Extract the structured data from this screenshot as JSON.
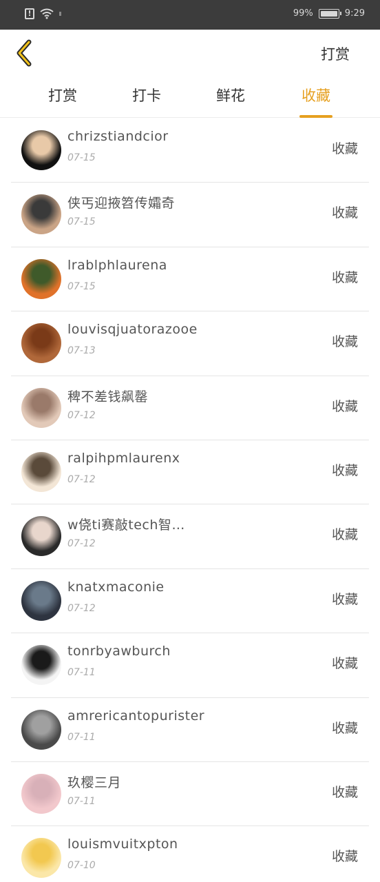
{
  "status_bar": {
    "battery_text": "99%",
    "battery_level": 0.99,
    "time": "9:29",
    "alert_icon": "!"
  },
  "header": {
    "back_icon": "chevron-left-icon",
    "right_label": "打赏",
    "accent_color": "#e6a020"
  },
  "tabs": [
    {
      "label": "打赏",
      "active": false
    },
    {
      "label": "打卡",
      "active": false
    },
    {
      "label": "鲜花",
      "active": false
    },
    {
      "label": "收藏",
      "active": true
    }
  ],
  "items": [
    {
      "name": "chrizstiandcior",
      "date": "07-15",
      "action": "收藏",
      "avatar_colors": [
        "#111111",
        "#e8c9a8"
      ]
    },
    {
      "name": "侠丐迎掖笤传孀奇",
      "date": "07-15",
      "action": "收藏",
      "avatar_colors": [
        "#caa486",
        "#3a3a3a"
      ]
    },
    {
      "name": "lrablphlaurena",
      "date": "07-15",
      "action": "收藏",
      "avatar_colors": [
        "#e0722a",
        "#3f5a2a"
      ]
    },
    {
      "name": "louvisqjuatorazooe",
      "date": "07-13",
      "action": "收藏",
      "avatar_colors": [
        "#b0683a",
        "#7a3a18"
      ]
    },
    {
      "name": "稗不差钱飙罄",
      "date": "07-12",
      "action": "收藏",
      "avatar_colors": [
        "#e2c9b8",
        "#9a7a6a"
      ]
    },
    {
      "name": "ralpihpmlaurenx",
      "date": "07-12",
      "action": "收藏",
      "avatar_colors": [
        "#f3e6d6",
        "#5a4a3a"
      ]
    },
    {
      "name": "w侥ti赛敲tech智…",
      "date": "07-12",
      "action": "收藏",
      "avatar_colors": [
        "#2a2a2a",
        "#e8d6cc"
      ]
    },
    {
      "name": "knatxmaconie",
      "date": "07-12",
      "action": "收藏",
      "avatar_colors": [
        "#2e3440",
        "#6a7a8a"
      ]
    },
    {
      "name": "tonrbyawburch",
      "date": "07-11",
      "action": "收藏",
      "avatar_colors": [
        "#f4f4f4",
        "#1a1a1a"
      ]
    },
    {
      "name": "amrericantopurister",
      "date": "07-11",
      "action": "收藏",
      "avatar_colors": [
        "#4a4a4a",
        "#a0a0a0"
      ]
    },
    {
      "name": "玖樱三月",
      "date": "07-11",
      "action": "收藏",
      "avatar_colors": [
        "#f2c8cc",
        "#d8b0b8"
      ]
    },
    {
      "name": "louismvuitxpton",
      "date": "07-10",
      "action": "收藏",
      "avatar_colors": [
        "#fbe7a8",
        "#f2c850"
      ]
    }
  ]
}
